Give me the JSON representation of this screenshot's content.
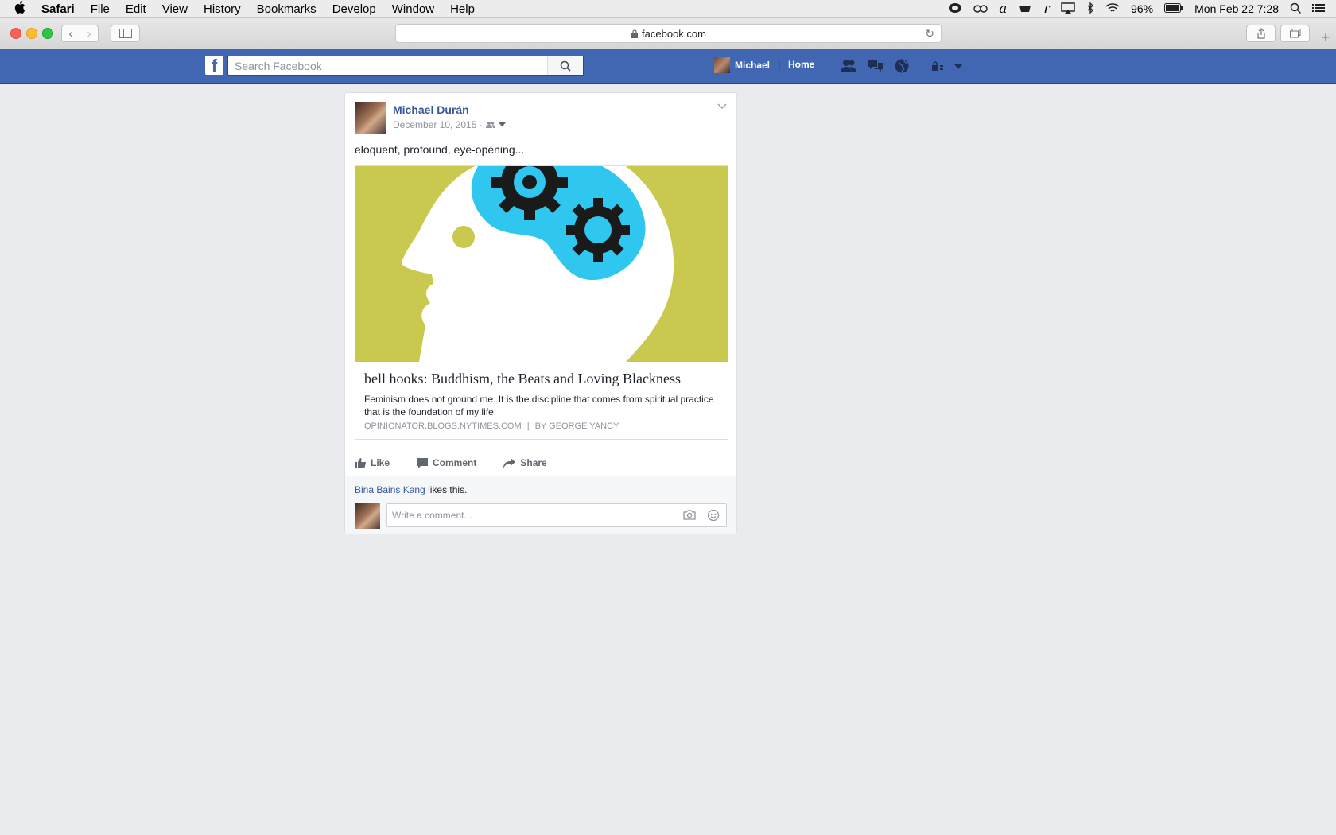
{
  "menubar": {
    "app": "Safari",
    "items": [
      "File",
      "Edit",
      "View",
      "History",
      "Bookmarks",
      "Develop",
      "Window",
      "Help"
    ],
    "battery": "96%",
    "datetime": "Mon Feb 22  7:28"
  },
  "browser": {
    "url": "facebook.com"
  },
  "fb_header": {
    "search_placeholder": "Search Facebook",
    "user_name": "Michael",
    "home_label": "Home"
  },
  "post": {
    "author": "Michael Durán",
    "date": "December 10, 2015 ·",
    "text": "eloquent, profound, eye-opening...",
    "link": {
      "title": "bell hooks: Buddhism, the Beats and Loving Blackness",
      "description": "Feminism does not ground me. It is the discipline that comes from spiritual practice that is the foundation of my life.",
      "source": "OPINIONATOR.BLOGS.NYTIMES.COM",
      "separator": "|",
      "byline": "BY GEORGE YANCY"
    },
    "actions": {
      "like": "Like",
      "comment": "Comment",
      "share": "Share"
    },
    "likes": {
      "name": "Bina Bains Kang",
      "suffix": "likes this."
    },
    "comment_placeholder": "Write a comment..."
  },
  "colors": {
    "fb_blue": "#4267b2",
    "link_blue": "#365899",
    "image_olive": "#c9c84f",
    "image_cyan": "#2fc6f0"
  }
}
